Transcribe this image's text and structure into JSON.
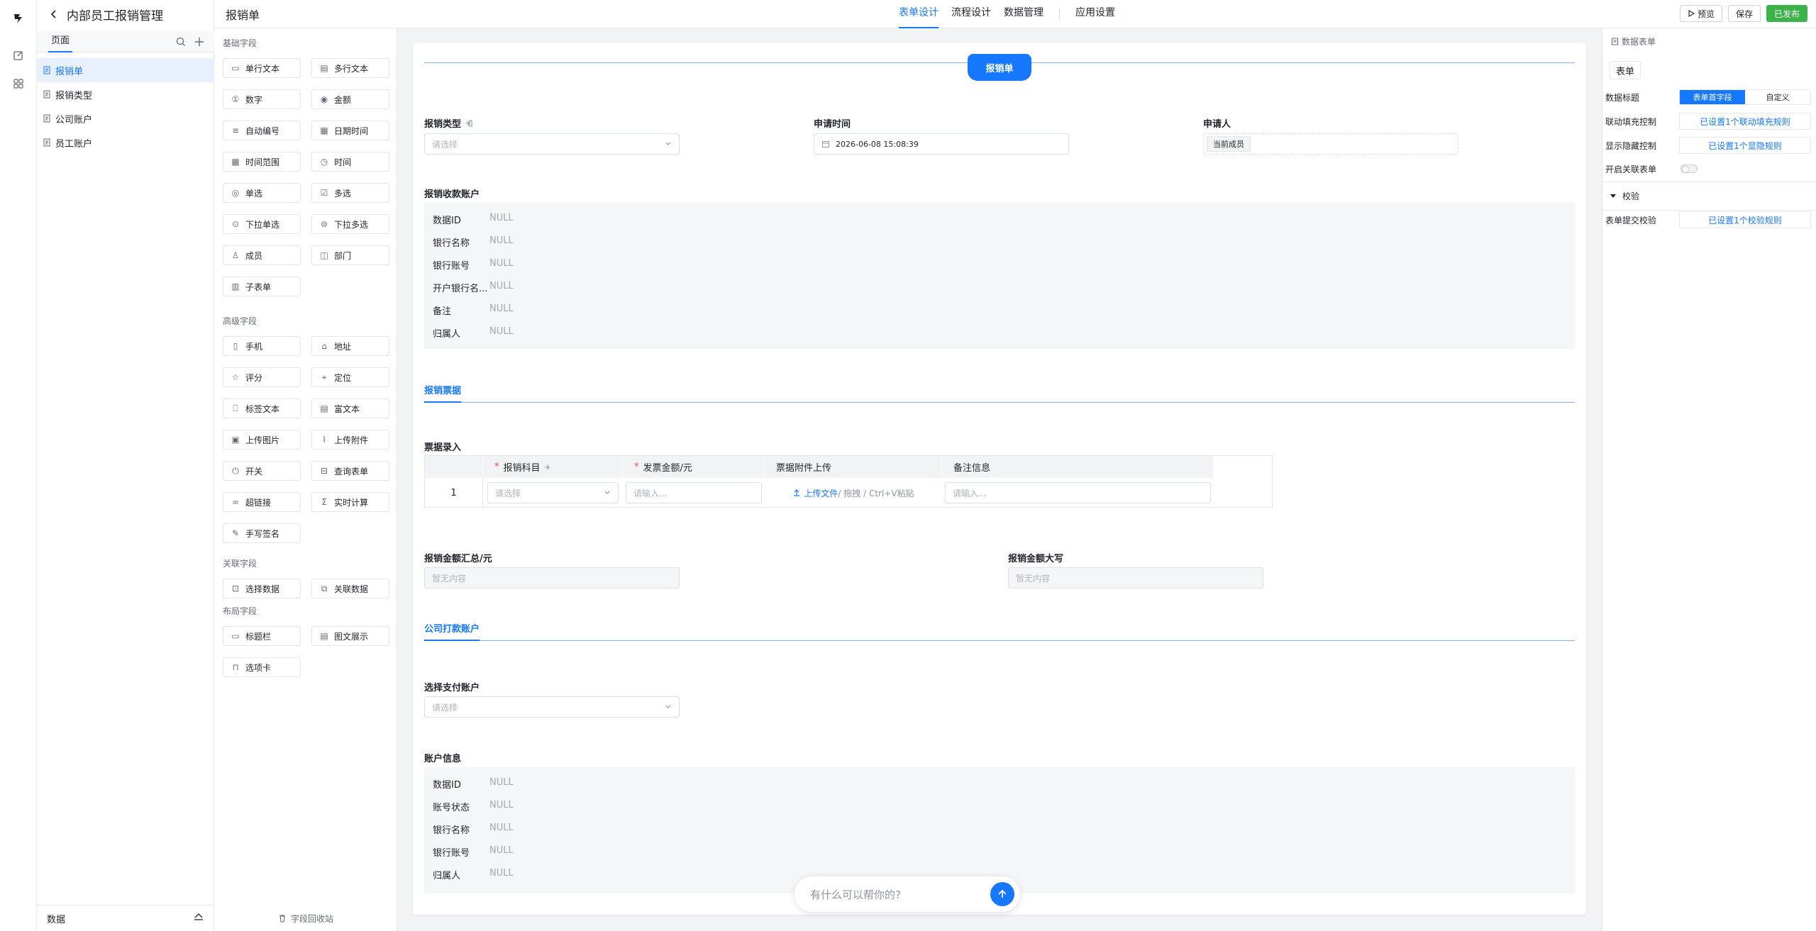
{
  "app": {
    "title": "内部员工报销管理"
  },
  "pages": {
    "tab_label": "页面",
    "items": [
      "报销单",
      "报销类型",
      "公司账户",
      "员工账户"
    ],
    "active_index": 0,
    "footer_label": "数据"
  },
  "header": {
    "form_name": "报销单",
    "tabs": [
      "表单设计",
      "流程设计",
      "数据管理",
      "应用设置"
    ],
    "active_tab": 0,
    "preview_label": "预览",
    "save_label": "保存",
    "publish_label": "已发布"
  },
  "palette": {
    "sections": [
      {
        "title": "基础字段",
        "items": [
          {
            "label": "单行文本",
            "icon": "text-line-icon"
          },
          {
            "label": "多行文本",
            "icon": "text-area-icon"
          },
          {
            "label": "数字",
            "icon": "number-icon"
          },
          {
            "label": "金额",
            "icon": "money-icon"
          },
          {
            "label": "自动编号",
            "icon": "serial-icon"
          },
          {
            "label": "日期时间",
            "icon": "calendar-icon"
          },
          {
            "label": "时间范围",
            "icon": "calendar-range-icon"
          },
          {
            "label": "时间",
            "icon": "clock-icon"
          },
          {
            "label": "单选",
            "icon": "radio-icon"
          },
          {
            "label": "多选",
            "icon": "checkbox-icon"
          },
          {
            "label": "下拉单选",
            "icon": "dropdown-single-icon"
          },
          {
            "label": "下拉多选",
            "icon": "dropdown-multi-icon"
          },
          {
            "label": "成员",
            "icon": "user-icon"
          },
          {
            "label": "部门",
            "icon": "department-icon"
          },
          {
            "label": "子表单",
            "icon": "subform-icon"
          }
        ]
      },
      {
        "title": "高级字段",
        "items": [
          {
            "label": "手机",
            "icon": "phone-icon"
          },
          {
            "label": "地址",
            "icon": "address-icon"
          },
          {
            "label": "评分",
            "icon": "star-icon"
          },
          {
            "label": "定位",
            "icon": "location-icon"
          },
          {
            "label": "标签文本",
            "icon": "bookmark-icon"
          },
          {
            "label": "富文本",
            "icon": "richtext-icon"
          },
          {
            "label": "上传图片",
            "icon": "image-icon"
          },
          {
            "label": "上传附件",
            "icon": "paperclip-icon"
          },
          {
            "label": "开关",
            "icon": "power-icon"
          },
          {
            "label": "查询表单",
            "icon": "query-icon"
          },
          {
            "label": "超链接",
            "icon": "link-icon"
          },
          {
            "label": "实时计算",
            "icon": "sigma-icon"
          },
          {
            "label": "手写签名",
            "icon": "pen-icon"
          }
        ]
      },
      {
        "title": "关联字段",
        "items": [
          {
            "label": "选择数据",
            "icon": "select-data-icon"
          },
          {
            "label": "关联数据",
            "icon": "linked-data-icon"
          }
        ]
      },
      {
        "title": "布局字段",
        "items": [
          {
            "label": "标题栏",
            "icon": "titlebar-icon"
          },
          {
            "label": "图文展示",
            "icon": "media-icon"
          },
          {
            "label": "选项卡",
            "icon": "tabs-icon"
          }
        ]
      }
    ],
    "recycle_label": "字段回收站"
  },
  "form": {
    "title": "报销单",
    "type_label": "报销类型",
    "type_placeholder": "请选择",
    "time_label": "申请时间",
    "time_value": "2026-06-08 15:08:39",
    "applicant_label": "申请人",
    "applicant_tag": "当前成员",
    "receive_account_label": "报销收款账户",
    "receive_account_rows": [
      {
        "key": "数据ID",
        "value": "NULL"
      },
      {
        "key": "银行名称",
        "value": "NULL"
      },
      {
        "key": "银行账号",
        "value": "NULL"
      },
      {
        "key": "开户银行名...",
        "value": "NULL"
      },
      {
        "key": "备注",
        "value": "NULL"
      },
      {
        "key": "归属人",
        "value": "NULL"
      }
    ],
    "section_invoice": "报销票据",
    "invoice_entry_label": "票据录入",
    "table_headers": [
      "报销科目",
      "发票金额/元",
      "票据附件上传",
      "备注信息"
    ],
    "row_index": "1",
    "subject_placeholder": "请选择",
    "amount_placeholder": "请输入...",
    "upload_link": "上传文件",
    "upload_hint": " / 拖拽 / Ctrl+V粘贴",
    "note_placeholder": "请输入...",
    "total_label": "报销金额汇总/元",
    "total_placeholder": "暂无内容",
    "upper_label": "报销金额大写",
    "upper_placeholder": "暂无内容",
    "section_company": "公司打款账户",
    "pay_account_label": "选择支付账户",
    "pay_account_placeholder": "请选择",
    "account_info_label": "账户信息",
    "account_info_rows": [
      {
        "key": "数据ID",
        "value": "NULL"
      },
      {
        "key": "账号状态",
        "value": "NULL"
      },
      {
        "key": "银行名称",
        "value": "NULL"
      },
      {
        "key": "银行账号",
        "value": "NULL"
      },
      {
        "key": "归属人",
        "value": "NULL"
      }
    ]
  },
  "chat": {
    "placeholder": "有什么可以帮你的?"
  },
  "props": {
    "header": "数据表单",
    "tab": "表单",
    "data_title_label": "数据标题",
    "seg_options": [
      "表单首字段",
      "自定义"
    ],
    "seg_active": 0,
    "linkage_label": "联动填充控制",
    "linkage_value": "已设置1个联动填充规则",
    "visibility_label": "显示隐藏控制",
    "visibility_value": "已设置1个显隐规则",
    "related_label": "开启关联表单",
    "related_on": false,
    "validate_section": "校验",
    "submit_check_label": "表单提交校验",
    "submit_check_value": "已设置1个校验规则"
  },
  "colors": {
    "accent": "#1677ff",
    "publish": "#3cb34a",
    "required": "#f54a45"
  }
}
